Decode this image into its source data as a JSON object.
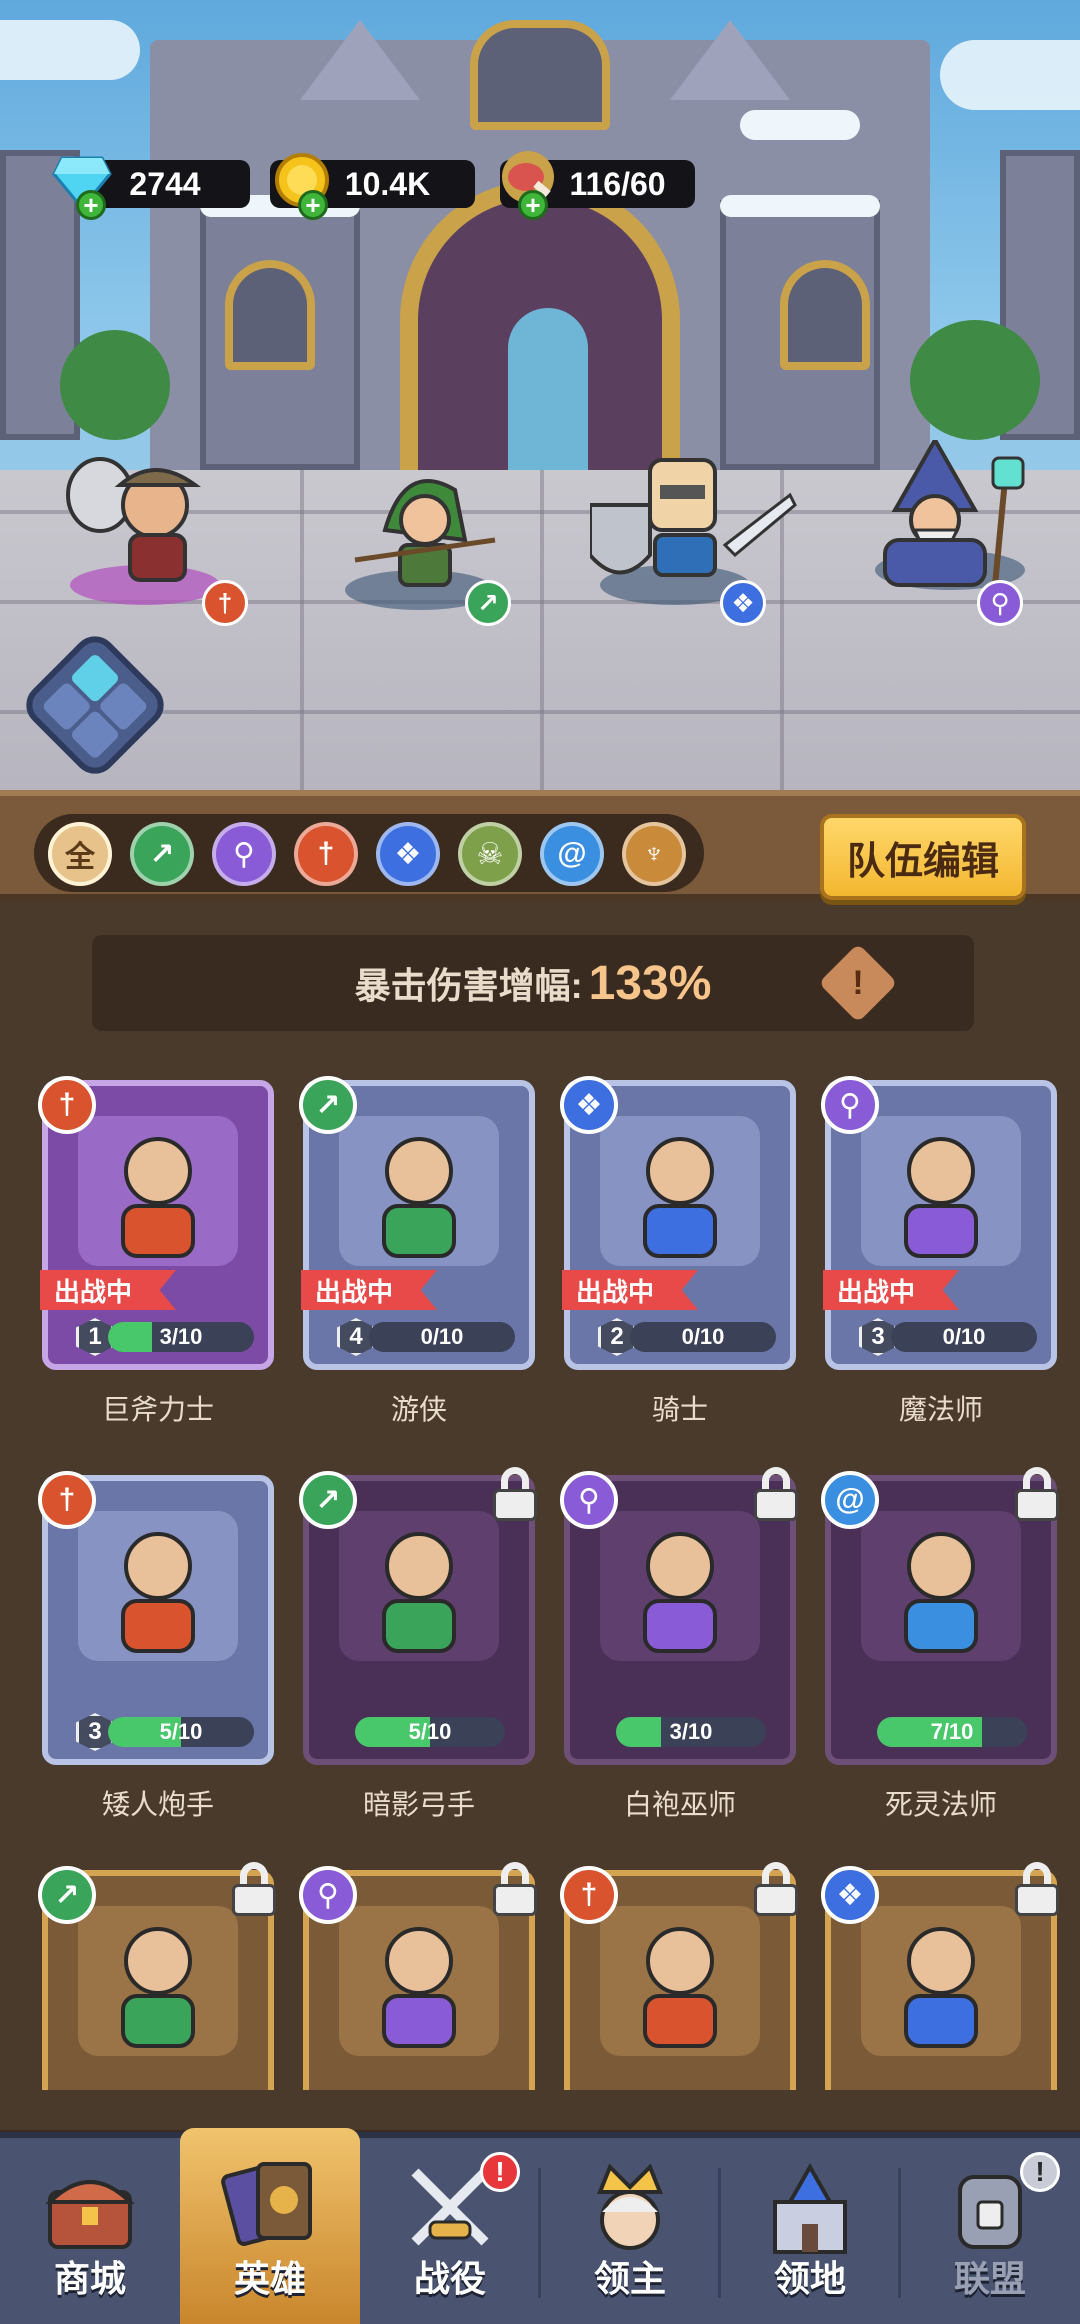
{
  "resources": {
    "gems": "2744",
    "gold": "10.4K",
    "stamina": "116/60"
  },
  "team": [
    {
      "name": "巨斧力士",
      "class": "warrior",
      "class_icon": "dagger-icon"
    },
    {
      "name": "游侠",
      "class": "ranger",
      "class_icon": "bow-icon"
    },
    {
      "name": "骑士",
      "class": "knight",
      "class_icon": "paw-icon"
    },
    {
      "name": "魔法师",
      "class": "mage",
      "class_icon": "staff-icon"
    }
  ],
  "filters": [
    {
      "label": "全",
      "icon": "all-icon",
      "color": "#e7c28a"
    },
    {
      "label": "",
      "icon": "bow-icon",
      "color": "#3aa45a"
    },
    {
      "label": "",
      "icon": "staff-icon",
      "color": "#8a5bd6"
    },
    {
      "label": "",
      "icon": "dagger-icon",
      "color": "#d8532e"
    },
    {
      "label": "",
      "icon": "paw-icon",
      "color": "#3d6fe0"
    },
    {
      "label": "",
      "icon": "skull-icon",
      "color": "#7ea04a"
    },
    {
      "label": "",
      "icon": "swirl-icon",
      "color": "#3a8fe0"
    },
    {
      "label": "",
      "icon": "wings-icon",
      "color": "#c98a3a"
    }
  ],
  "team_edit_label": "队伍编辑",
  "crit": {
    "label": "暴击伤害增幅:",
    "value": "133%",
    "info": "!"
  },
  "deployed_label": "出战中",
  "heroes": [
    {
      "name": "巨斧力士",
      "level": "1",
      "progress": "3/10",
      "fill": 0.3,
      "state": "deployed",
      "rarity": "purple",
      "class_color": "#d8532e",
      "class_icon": "dagger-icon"
    },
    {
      "name": "游侠",
      "level": "4",
      "progress": "0/10",
      "fill": 0,
      "state": "deployed",
      "rarity": "blue",
      "class_color": "#3aa45a",
      "class_icon": "bow-icon"
    },
    {
      "name": "骑士",
      "level": "2",
      "progress": "0/10",
      "fill": 0,
      "state": "deployed",
      "rarity": "blue",
      "class_color": "#3d6fe0",
      "class_icon": "paw-icon"
    },
    {
      "name": "魔法师",
      "level": "3",
      "progress": "0/10",
      "fill": 0,
      "state": "deployed",
      "rarity": "blue",
      "class_color": "#8a5bd6",
      "class_icon": "staff-icon"
    },
    {
      "name": "矮人炮手",
      "level": "3",
      "progress": "5/10",
      "fill": 0.5,
      "state": "owned",
      "rarity": "blue",
      "class_color": "#d8532e",
      "class_icon": "dagger-icon"
    },
    {
      "name": "暗影弓手",
      "level": "",
      "progress": "5/10",
      "fill": 0.5,
      "state": "locked",
      "rarity": "dark",
      "class_color": "#3aa45a",
      "class_icon": "bow-icon"
    },
    {
      "name": "白袍巫师",
      "level": "",
      "progress": "3/10",
      "fill": 0.3,
      "state": "locked",
      "rarity": "dark",
      "class_color": "#8a5bd6",
      "class_icon": "staff-icon"
    },
    {
      "name": "死灵法师",
      "level": "",
      "progress": "7/10",
      "fill": 0.7,
      "state": "locked",
      "rarity": "dark",
      "class_color": "#3a8fe0",
      "class_icon": "swirl-icon"
    },
    {
      "name": "",
      "state": "locked",
      "rarity": "gold",
      "class_color": "#3aa45a",
      "class_icon": "bow-icon"
    },
    {
      "name": "",
      "state": "locked",
      "rarity": "gold",
      "class_color": "#8a5bd6",
      "class_icon": "staff-icon"
    },
    {
      "name": "",
      "state": "locked",
      "rarity": "gold",
      "class_color": "#d8532e",
      "class_icon": "dagger-icon"
    },
    {
      "name": "",
      "state": "locked",
      "rarity": "gold",
      "class_color": "#3d6fe0",
      "class_icon": "paw-icon"
    }
  ],
  "nav": [
    {
      "label": "商城",
      "icon": "treasure-chest-icon",
      "active": false,
      "alert": false
    },
    {
      "label": "英雄",
      "icon": "hero-cards-icon",
      "active": true,
      "alert": false
    },
    {
      "label": "战役",
      "icon": "crossed-swords-icon",
      "active": false,
      "alert": true
    },
    {
      "label": "领主",
      "icon": "crowned-lord-icon",
      "active": false,
      "alert": false
    },
    {
      "label": "领地",
      "icon": "castle-icon",
      "active": false,
      "alert": false
    },
    {
      "label": "联盟",
      "icon": "guild-icon",
      "active": false,
      "alert": true,
      "disabled": true
    }
  ],
  "alert_mark": "!"
}
